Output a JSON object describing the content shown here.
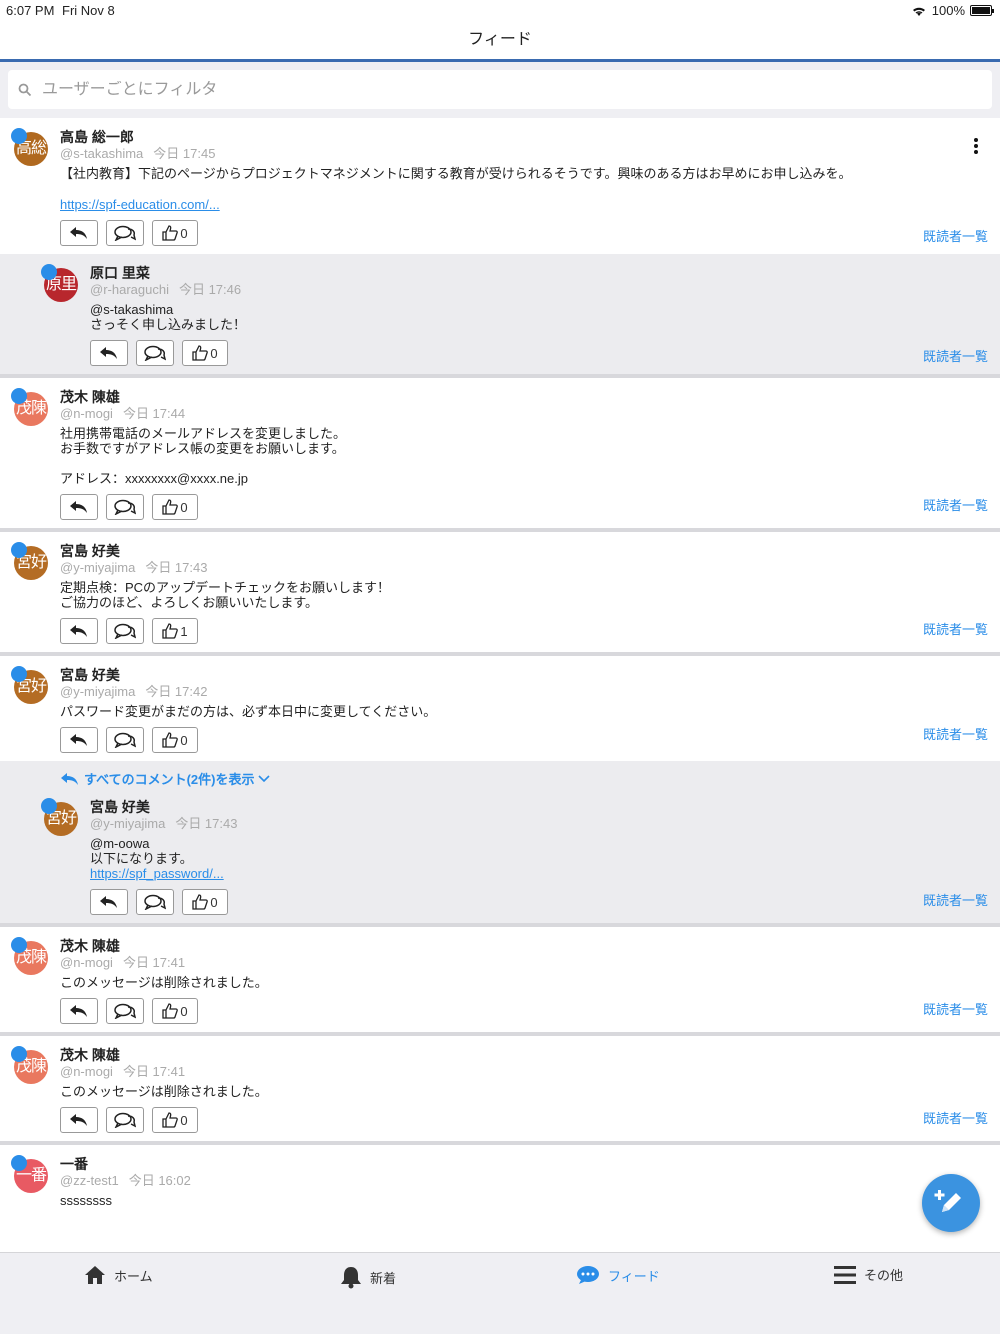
{
  "status": {
    "time": "6:07 PM",
    "date": "Fri Nov 8",
    "battery": "100%"
  },
  "nav": {
    "title": "フィード"
  },
  "search": {
    "placeholder": "ユーザーごとにフィルタ"
  },
  "common": {
    "readers_label": "既読者一覧"
  },
  "posts": [
    {
      "avatar": "高総",
      "avatar_color": "#b0691f",
      "name": "高島 総一郎",
      "handle": "@s-takashima",
      "time": "今日 17:45",
      "text": "【社内教育】下記のページからプロジェクトマネジメントに関する教育が受けられるそうです。興味のある方はお早めにお申し込みを。",
      "link": "https://spf-education.com/...",
      "likes": "0",
      "comments": [
        {
          "avatar": "原里",
          "avatar_color": "#b8272d",
          "name": "原口 里菜",
          "handle": "@r-haraguchi",
          "time": "今日 17:46",
          "text": "@s-takashima\nさっそく申し込みました！",
          "likes": "0"
        }
      ]
    },
    {
      "avatar": "茂陳",
      "avatar_color": "#e9785f",
      "name": "茂木 陳雄",
      "handle": "@n-mogi",
      "time": "今日 17:44",
      "text": "社用携帯電話のメールアドレスを変更しました。\nお手数ですがアドレス帳の変更をお願いします。\n\nアドレス：xxxxxxxx@xxxx.ne.jp",
      "likes": "0"
    },
    {
      "avatar": "宮好",
      "avatar_color": "#b46c24",
      "name": "宮島 好美",
      "handle": "@y-miyajima",
      "time": "今日 17:43",
      "text": "定期点検：PCのアップデートチェックをお願いします！\nご協力のほど、よろしくお願いいたします。",
      "likes": "1"
    },
    {
      "avatar": "宮好",
      "avatar_color": "#b46c24",
      "name": "宮島 好美",
      "handle": "@y-miyajima",
      "time": "今日 17:42",
      "text": "パスワード変更がまだの方は、必ず本日中に変更してください。",
      "likes": "0",
      "show_all": "すべてのコメント(2件)を表示",
      "comments": [
        {
          "avatar": "宮好",
          "avatar_color": "#b46c24",
          "name": "宮島 好美",
          "handle": "@y-miyajima",
          "time": "今日 17:43",
          "text": "@m-oowa\n以下になります。",
          "link": "https://spf_password/...",
          "likes": "0"
        }
      ]
    },
    {
      "avatar": "茂陳",
      "avatar_color": "#e9785f",
      "name": "茂木 陳雄",
      "handle": "@n-mogi",
      "time": "今日 17:41",
      "text": "このメッセージは削除されました。",
      "likes": "0"
    },
    {
      "avatar": "茂陳",
      "avatar_color": "#e9785f",
      "name": "茂木 陳雄",
      "handle": "@n-mogi",
      "time": "今日 17:41",
      "text": "このメッセージは削除されました。",
      "likes": "0"
    },
    {
      "avatar": "一番",
      "avatar_color": "#e85a63",
      "name": "一番",
      "handle": "@zz-test1",
      "time": "今日 16:02",
      "text": "ssssssss"
    }
  ],
  "tabs": [
    {
      "label": "ホーム",
      "icon": "home-icon"
    },
    {
      "label": "新着",
      "icon": "bell-icon"
    },
    {
      "label": "フィード",
      "icon": "chat-icon",
      "active": true
    },
    {
      "label": "その他",
      "icon": "menu-icon"
    }
  ],
  "colors": {
    "accent": "#2a8de8",
    "nav_underline": "#3a6bb0"
  }
}
